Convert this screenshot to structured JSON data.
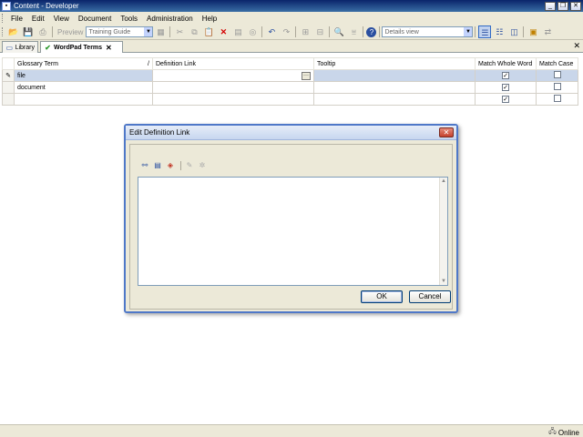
{
  "window": {
    "title": "Content - Developer"
  },
  "menu": [
    "File",
    "Edit",
    "View",
    "Document",
    "Tools",
    "Administration",
    "Help"
  ],
  "toolbar": {
    "preview_label": "Preview",
    "project_select": "Training Guide",
    "view_select": "Details view"
  },
  "tabs": [
    {
      "label": "Library",
      "icon": "library-icon"
    },
    {
      "label": "WordPad Terms",
      "icon": "glossary-icon"
    }
  ],
  "grid": {
    "columns": [
      "Glossary Term",
      "Definition Link",
      "Tooltip",
      "Match Whole Word",
      "Match Case"
    ],
    "rows": [
      {
        "term": "file",
        "definition": "",
        "tooltip": "",
        "match_whole_word": true,
        "match_case": false
      },
      {
        "term": "document",
        "definition": "",
        "tooltip": "",
        "match_whole_word": true,
        "match_case": false
      },
      {
        "term": "",
        "definition": "",
        "tooltip": "",
        "match_whole_word": true,
        "match_case": false
      }
    ]
  },
  "dialog": {
    "title": "Edit Definition Link",
    "ok_label": "OK",
    "cancel_label": "Cancel",
    "tools": [
      "link-icon",
      "document-link-icon",
      "package-link-icon",
      "edit-icon",
      "remove-link-icon"
    ]
  },
  "status": {
    "online_label": "Online"
  },
  "colors": {
    "selected_row": "#c9d6ea",
    "dialog_border": "#4f78c8",
    "title_bar": "#0a246a"
  }
}
